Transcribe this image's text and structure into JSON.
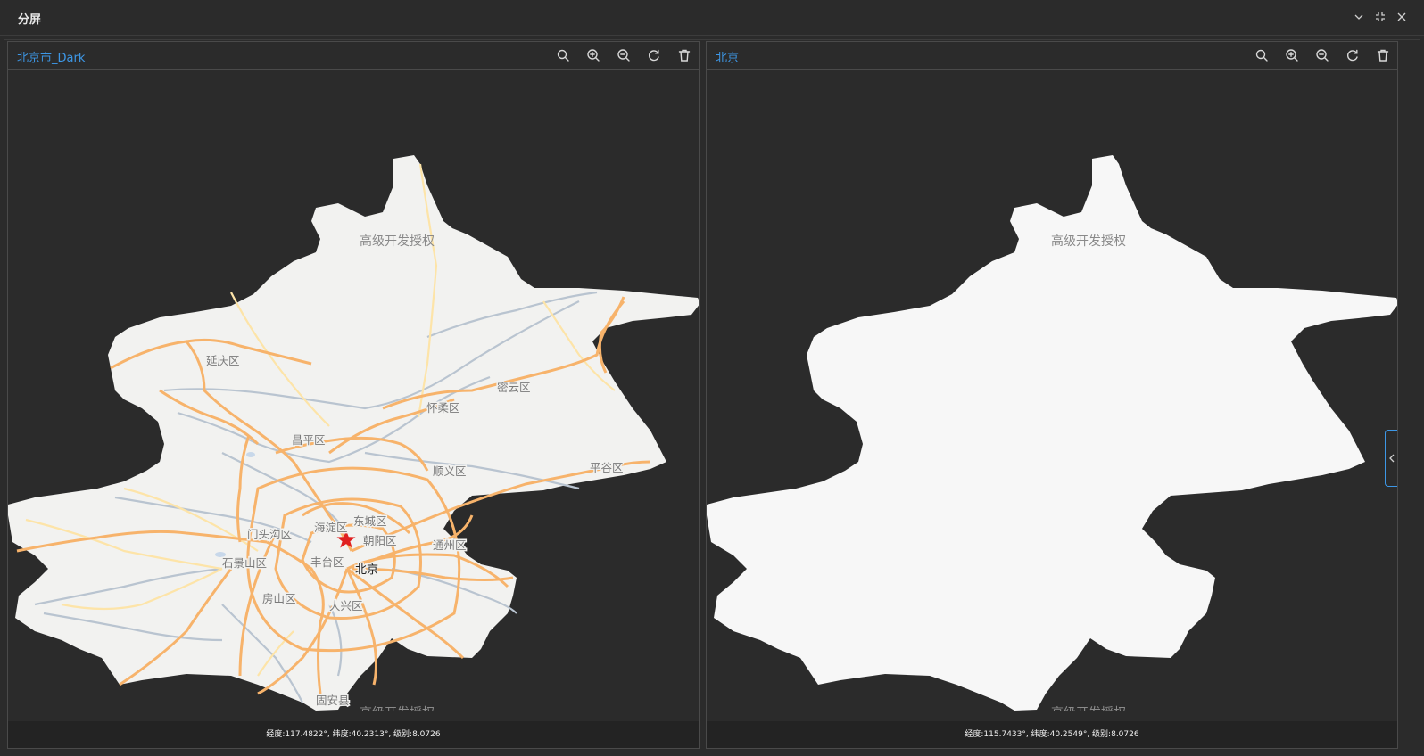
{
  "window": {
    "title": "分屏"
  },
  "left_panel": {
    "title": "北京市_Dark",
    "status": "经度:117.4822°, 纬度:40.2313°, 级别:8.0726",
    "watermark": "高级开发授权",
    "districts": {
      "yanqing": "延庆区",
      "miyun": "密云区",
      "huairou": "怀柔区",
      "changping": "昌平区",
      "pinggu": "平谷区",
      "shunyi": "顺义区",
      "dongcheng": "东城区",
      "haidian": "海淀区",
      "chaoyang": "朝阳区",
      "mentougou": "门头沟区",
      "tongzhou": "通州区",
      "shijingshan": "石景山区",
      "fengtai": "丰台区",
      "fangshan": "房山区",
      "daxing": "大兴区",
      "guan": "固安县"
    },
    "city": "北京"
  },
  "right_panel": {
    "title": "北京",
    "status": "经度:115.7433°, 纬度:40.2549°, 级别:8.0726",
    "watermark": "高级开发授权"
  },
  "icons": [
    "chevron-down-icon",
    "collapse-icon",
    "close-icon",
    "search-icon",
    "zoom-in-icon",
    "zoom-out-icon",
    "refresh-icon",
    "trash-icon",
    "chevron-left-icon"
  ],
  "colors": {
    "accent": "#3d97e6",
    "background": "#2b2b2b",
    "map_land": "#f2f2f0",
    "road_major": "#f7b36b",
    "road_minor": "#fde4a8",
    "river": "#b9c4d0",
    "capital_star": "#e02020"
  }
}
